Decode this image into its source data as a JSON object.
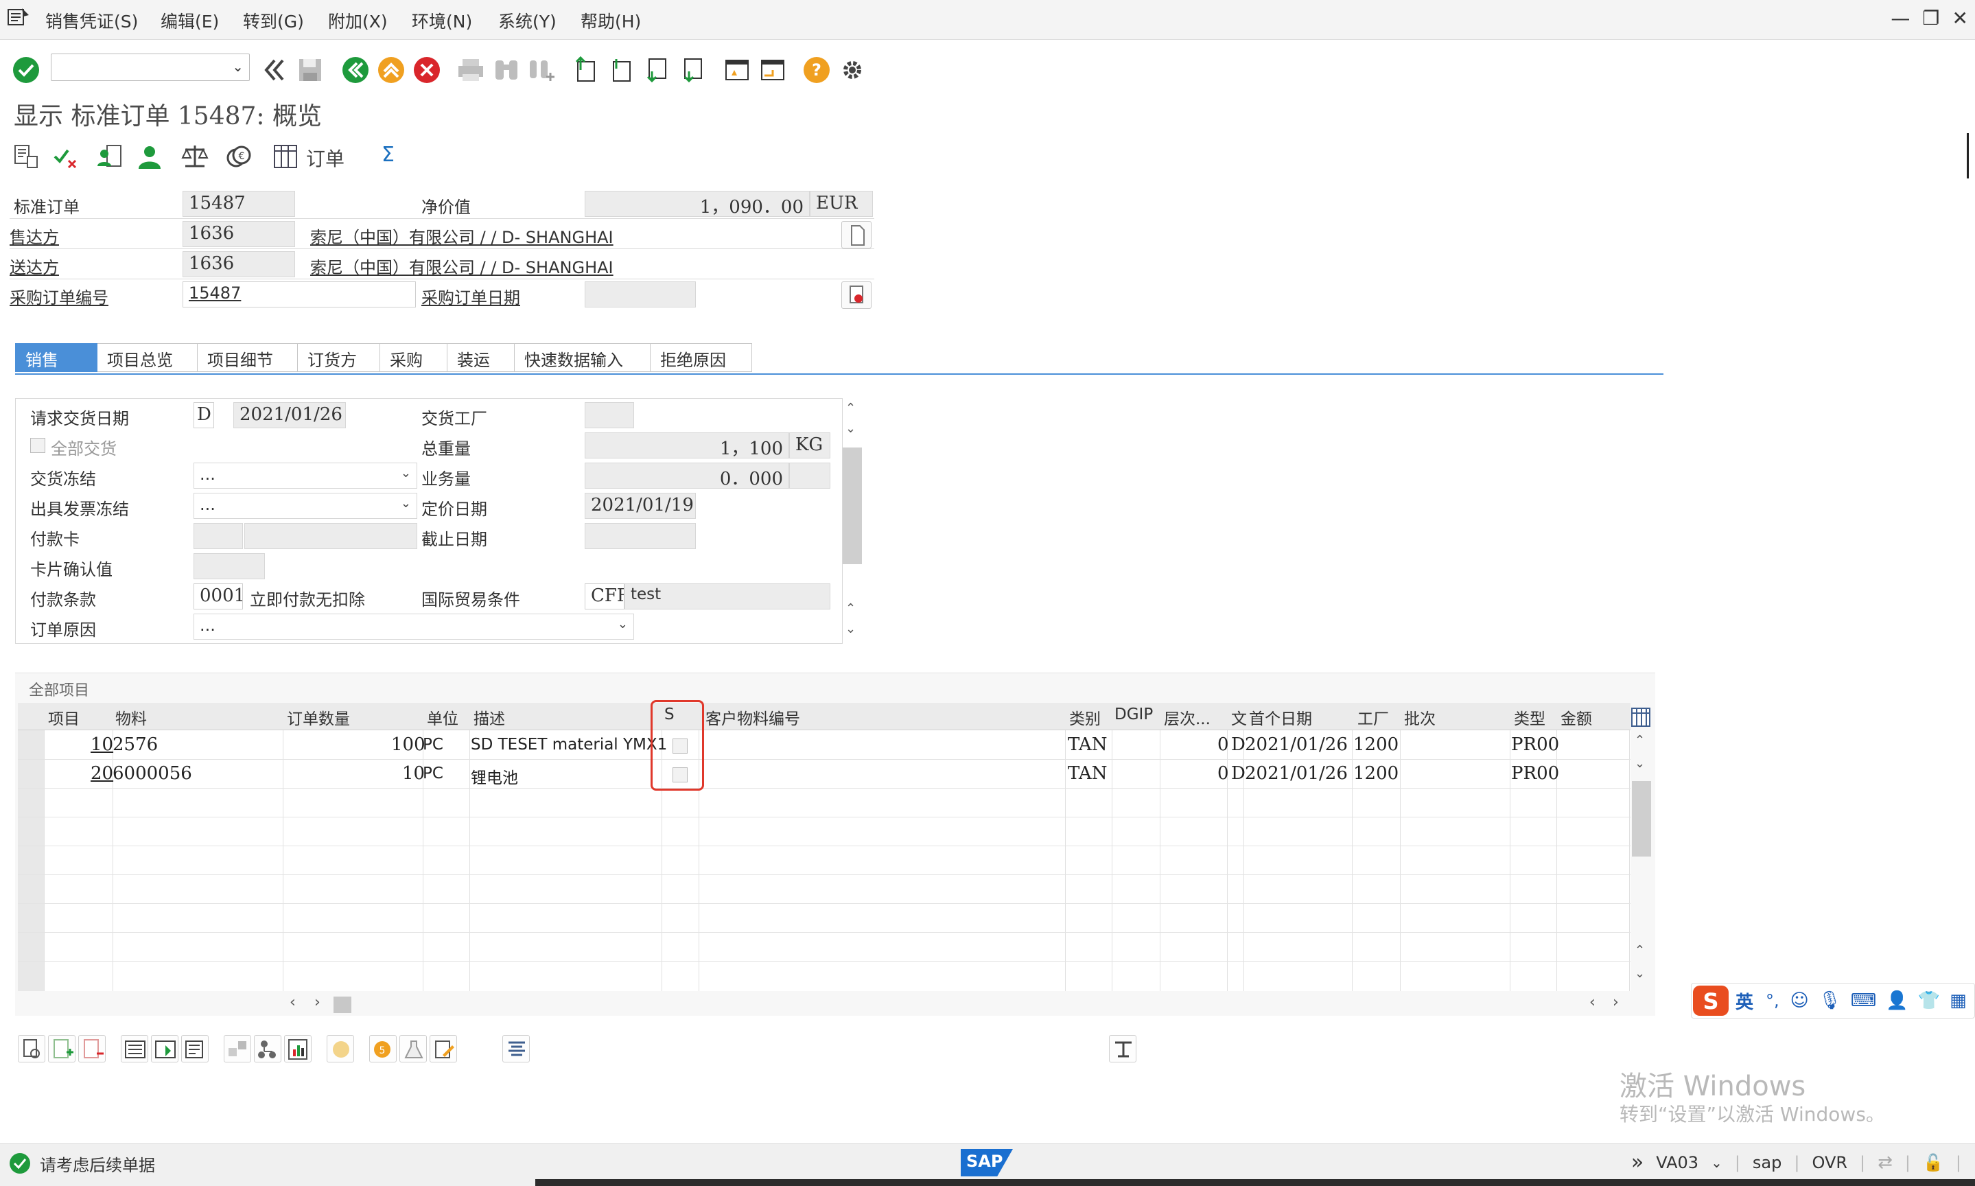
{
  "menu": {
    "items": [
      "销售凭证(S)",
      "编辑(E)",
      "转到(G)",
      "附加(X)",
      "环境(N)",
      "系统(Y)",
      "帮助(H)"
    ]
  },
  "window_controls": [
    "—",
    "❐",
    "✕"
  ],
  "page_title": "显示 标准订单 15487: 概览",
  "app_toolbar": {
    "order_label": "订单",
    "sigma": "Σ"
  },
  "header": {
    "standard_order_label": "标准订单",
    "standard_order_value": "15487",
    "net_value_label": "净价值",
    "net_value": "1，090．00",
    "currency": "EUR",
    "sold_to_label": "售达方",
    "sold_to_value": "1636",
    "sold_to_name": "索尼（中国）有限公司 / / D- SHANGHAI",
    "ship_to_label": "送达方",
    "ship_to_value": "1636",
    "ship_to_name": "索尼（中国）有限公司 / / D- SHANGHAI",
    "po_number_label": "采购订单编号",
    "po_number_value": "15487",
    "po_date_label": "采购订单日期",
    "po_date_value": ""
  },
  "tabs": [
    "销售",
    "项目总览",
    "项目细节",
    "订货方",
    "采购",
    "装运",
    "快速数据输入",
    "拒绝原因"
  ],
  "sales": {
    "req_delivery_date_label": "请求交货日期",
    "req_delivery_date_type": "D",
    "req_delivery_date": "2021/01/26",
    "delivery_plant_label": "交货工厂",
    "delivery_plant_value": "",
    "complete_delivery_label": "全部交货",
    "total_weight_label": "总重量",
    "total_weight": "1，100",
    "weight_unit": "KG",
    "delivery_block_label": "交货冻结",
    "delivery_block_value": "...",
    "volume_label": "业务量",
    "volume": "0．000",
    "billing_block_label": "出具发票冻结",
    "billing_block_value": "...",
    "pricing_date_label": "定价日期",
    "pricing_date": "2021/01/19",
    "payment_card_label": "付款卡",
    "cutoff_date_label": "截止日期",
    "card_verif_label": "卡片确认值",
    "payment_terms_label": "付款条款",
    "payment_terms_code": "0001",
    "payment_terms_text": "立即付款无扣除",
    "incoterms_label": "国际贸易条件",
    "incoterms_code": "CFR",
    "incoterms_text": "test",
    "order_reason_label": "订单原因",
    "order_reason_value": "..."
  },
  "items": {
    "panel_title": "全部项目",
    "columns": [
      "项目",
      "物料",
      "订单数量",
      "单位",
      "描述",
      "S",
      "客户物料编号",
      "类别",
      "DGIP",
      "层次...",
      "文",
      "首个日期",
      "工厂",
      "批次",
      "类型",
      "金额"
    ],
    "rows": [
      {
        "item": "10",
        "material": "2576",
        "qty": "100",
        "unit": "PC",
        "desc": "SD TESET material YMX1",
        "cat": "TAN",
        "level": "0",
        "d": "D",
        "first_date": "2021/01/26",
        "plant": "1200",
        "type": "PR00"
      },
      {
        "item": "20",
        "material": "6000056",
        "qty": "10",
        "unit": "PC",
        "desc": "锂电池",
        "cat": "TAN",
        "level": "0",
        "d": "D",
        "first_date": "2021/01/26",
        "plant": "1200",
        "type": "PR00"
      }
    ]
  },
  "status": {
    "message": "请考虑后续单据",
    "transaction": "VA03",
    "system": "sap",
    "mode": "OVR",
    "sap_logo": "SAP"
  },
  "ime": {
    "lang": "英"
  },
  "watermark": {
    "line1": "激活 Windows",
    "line2": "转到“设置”以激活 Windows。"
  },
  "colors": {
    "accent": "#4a8fd8",
    "highlight": "#e0382b",
    "ok_green": "#1e9a3c",
    "cancel_red": "#d9262b",
    "orange": "#f0a020"
  }
}
